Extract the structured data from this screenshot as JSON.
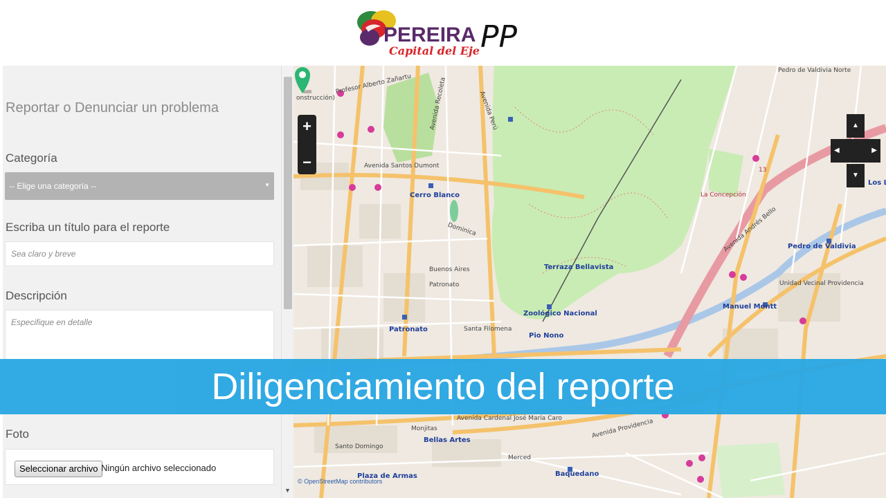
{
  "logo": {
    "wordmark": "PEREIRA",
    "tagline": "Capital del Eje",
    "suffix": "PP"
  },
  "form": {
    "title": "Reportar o Denunciar un problema",
    "category_label": "Categoría",
    "category_value": "-- Elige una categoría --",
    "title_label": "Escriba un título para el reporte",
    "title_placeholder": "Sea claro y breve",
    "description_label": "Descripción",
    "description_placeholder": "Especifique en detalle",
    "photo_label": "Foto",
    "file_button": "Seleccionar archivo",
    "file_status": "Ningún archivo seleccionado"
  },
  "map": {
    "zoom_in": "+",
    "zoom_out": "−",
    "pan_up": "▲",
    "pan_down": "▼",
    "pan_left": "◀",
    "pan_right": "▶",
    "attribution": "© OpenStreetMap contributors",
    "labels": {
      "cerro_blanco": "Cerro Blanco",
      "patronato": "Patronato",
      "terraza": "Terraza Bellavista",
      "zoologico": "Zoológico Nacional",
      "pio_nono": "Pio Nono",
      "bellas_artes": "Bellas Artes",
      "baquedano": "Baquedano",
      "plaza_armas": "Plaza de Armas",
      "manuel_montt": "Manuel Montt",
      "pedro_valdivia": "Pedro de Valdivia",
      "la_concepcion": "La Concepción",
      "los_leones": "Los Leo",
      "santo_domingo": "Santo Domingo",
      "av_recoleta": "Avenida Recoleta",
      "av_peru": "Avenida Perú",
      "av_santos_dumont": "Avenida Santos Dumont",
      "dominica": "Dominica",
      "av_cardenal": "Avenida Cardenal José María Caro",
      "av_providencia": "Avenida Providencia",
      "av_andres_bello": "Avenida Andrés Bello",
      "unidad_vecinal": "Unidad Vecinal Providencia",
      "construccion": "onstrucción)",
      "profesor_zanartu": "Profesor Alberto Zañartu",
      "pedro_valdivia_norte": "Pedro de Valdivia Norte",
      "santa_filomena": "Santa Filomena",
      "buenos_aires": "Buenos Aires",
      "merced": "Merced",
      "monjitas": "Monjitas",
      "route_13": "13"
    }
  },
  "banner": {
    "text": "Diligenciamiento del reporte"
  },
  "colors": {
    "banner": "#2aa7e3",
    "park_green": "#c9ecb4",
    "major_road": "#f5c26b",
    "marker": "#2bb673"
  }
}
